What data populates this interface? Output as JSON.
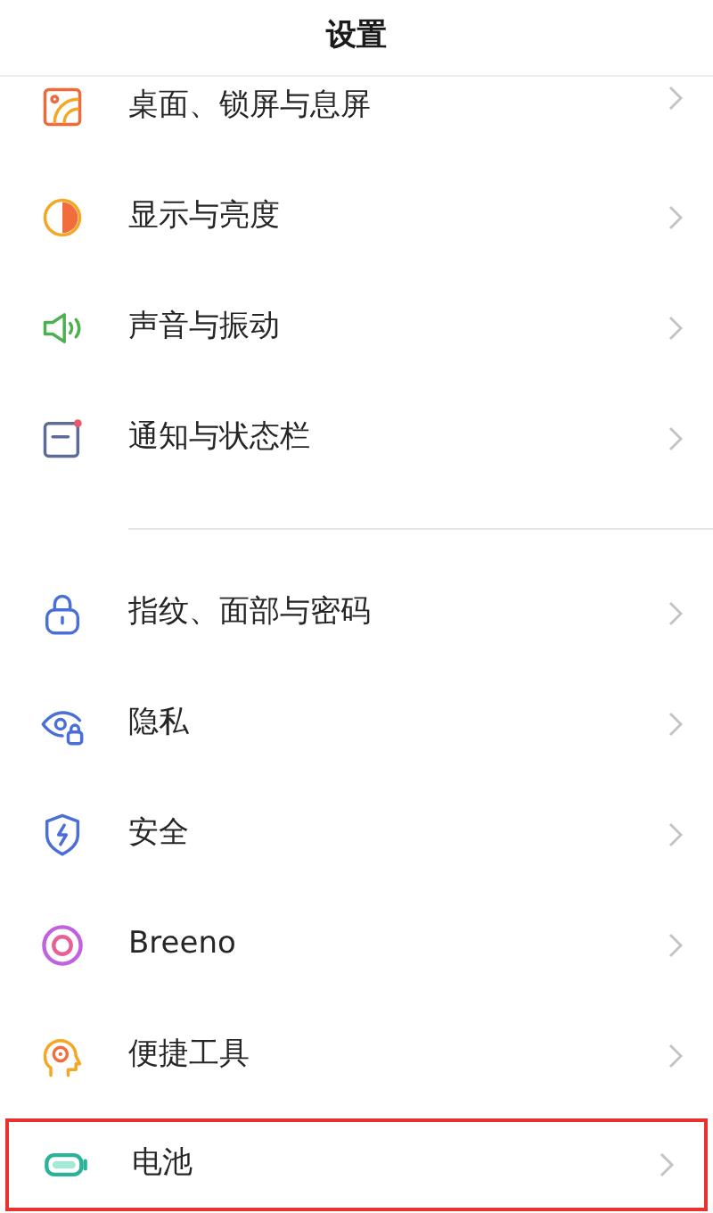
{
  "header": {
    "title": "设置"
  },
  "groups": [
    {
      "items": [
        {
          "label": "桌面、锁屏与息屏",
          "kind": "wallpaper",
          "highlighted": false
        },
        {
          "label": "显示与亮度",
          "kind": "display",
          "highlighted": false
        },
        {
          "label": "声音与振动",
          "kind": "sound",
          "highlighted": false
        },
        {
          "label": "通知与状态栏",
          "kind": "notification",
          "highlighted": false
        }
      ]
    },
    {
      "items": [
        {
          "label": "指纹、面部与密码",
          "kind": "lock",
          "highlighted": false
        },
        {
          "label": "隐私",
          "kind": "privacy",
          "highlighted": false
        },
        {
          "label": "安全",
          "kind": "security",
          "highlighted": false
        },
        {
          "label": "Breeno",
          "kind": "breeno",
          "highlighted": false
        },
        {
          "label": "便捷工具",
          "kind": "tools",
          "highlighted": false
        },
        {
          "label": "电池",
          "kind": "battery",
          "highlighted": true
        }
      ]
    }
  ]
}
